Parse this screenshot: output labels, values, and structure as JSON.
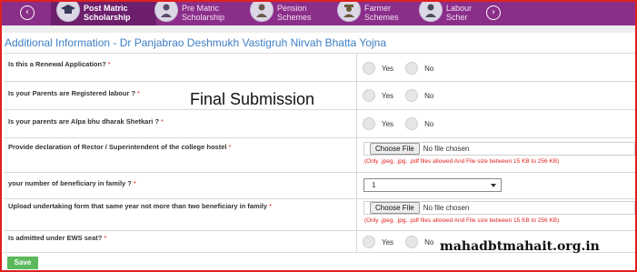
{
  "nav": {
    "prev_glyph": "‹",
    "next_glyph": "›",
    "items": [
      {
        "label": "Post Matric Scholarship",
        "icon": "graduate-icon",
        "active": true
      },
      {
        "label": "Pre Matric Scholarship",
        "icon": "student-icon",
        "active": false
      },
      {
        "label": "Pension Schemes",
        "icon": "elder-icon",
        "active": false
      },
      {
        "label": "Farmer Schemes",
        "icon": "farmer-icon",
        "active": false
      },
      {
        "label": "Labour Scher",
        "icon": "labour-icon",
        "active": false
      }
    ],
    "colors": {
      "band": "#8b2e8a",
      "active": "#6d1f6c"
    }
  },
  "heading": "Additional Information - Dr Panjabrao Deshmukh Vastigruh Nirvah Bhatta Yojna",
  "overlay_title": "Final Submission",
  "watermark": "mahadbtmahait.org.in",
  "required_mark": "*",
  "questions": {
    "renewal": {
      "label": "Is this a Renewal Application?",
      "yes": "Yes",
      "no": "No"
    },
    "parents_labour": {
      "label": "Is your Parents are Registered labour ?",
      "yes": "Yes",
      "no": "No"
    },
    "alpa_bhu": {
      "label": "Is your parents are Alpa bhu dharak Shetkari ?",
      "yes": "Yes",
      "no": "No"
    },
    "declaration": {
      "label": "Provide declaration of Rector / Superintendent of the college hostel",
      "button": "Choose File",
      "status": "No file chosen",
      "note": "(Only .jpeg, .jpg, .pdf files allowed And File size between 15 KB to 256 KB)"
    },
    "beneficiary": {
      "label": "your number of beneficiary in family ?",
      "value": "1"
    },
    "undertaking": {
      "label": "Upload undertaking form that same year not more than two beneficiary in family",
      "button": "Choose File",
      "status": "No file chosen",
      "note": "(Only .jpeg, .jpg, .pdf files allowed And File size between 15 KB to 256 KB)"
    },
    "ews": {
      "label": "Is admitted under EWS seat?",
      "yes": "Yes",
      "no": "No"
    }
  },
  "save_label": "Save",
  "colors": {
    "heading": "#3d7ec4",
    "required": "#e02020",
    "save": "#5cb85c",
    "border": "#e02020"
  }
}
